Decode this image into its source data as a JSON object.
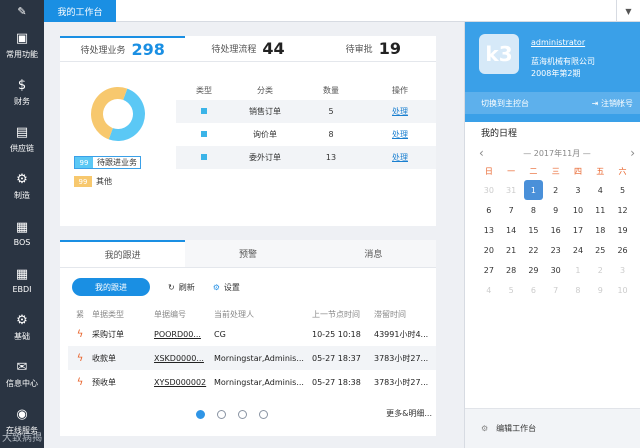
{
  "nav": {
    "items": [
      {
        "label": "常用功能",
        "icon": "bookmark-icon",
        "glyph": "▣"
      },
      {
        "label": "财务",
        "icon": "finance-coin-icon",
        "glyph": "$"
      },
      {
        "label": "供应链",
        "icon": "box-icon",
        "glyph": "▤"
      },
      {
        "label": "制造",
        "icon": "gear-icon",
        "glyph": "⚙"
      },
      {
        "label": "BOS",
        "icon": "grid-icon",
        "glyph": "▦"
      },
      {
        "label": "EBDI",
        "icon": "grid-icon",
        "glyph": "▦"
      },
      {
        "label": "基础",
        "icon": "settings-icon",
        "glyph": "⚙"
      },
      {
        "label": "信息中心",
        "icon": "mail-icon",
        "glyph": "✉"
      },
      {
        "label": "在线服务",
        "icon": "service-icon",
        "glyph": "◉"
      }
    ],
    "watermark": "大致病揭"
  },
  "topbar": {
    "tab_label": "我的工作台",
    "dropdown": "▼"
  },
  "summary": {
    "stats": [
      {
        "label": "待处理业务",
        "count": "298"
      },
      {
        "label": "待处理流程",
        "count": "44"
      },
      {
        "label": "待审批",
        "count": "19"
      }
    ],
    "donut": [
      {
        "name": "待跟进业务",
        "value": 99,
        "color": "#5bc8f5"
      },
      {
        "name": "其他",
        "value": 99,
        "color": "#f7c86e"
      }
    ],
    "legend": [
      {
        "badge": "99",
        "label": "待跟进业务",
        "color": "#5bc8f5"
      },
      {
        "badge": "99",
        "label": "其他",
        "color": "#f7c86e"
      }
    ],
    "table": {
      "headers": [
        "类型",
        "分类",
        "数量",
        "操作"
      ],
      "rows": [
        {
          "category": "销售订单",
          "count": "5",
          "action": "处理"
        },
        {
          "category": "询价单",
          "count": "8",
          "action": "处理"
        },
        {
          "category": "委外订单",
          "count": "13",
          "action": "处理"
        }
      ]
    }
  },
  "followup": {
    "tabs": [
      "我的跟进",
      "预警",
      "消息"
    ],
    "toolbar": {
      "mine": "我的跟进",
      "refresh": "刷新",
      "settings": "设置"
    },
    "headers": [
      "紧",
      "单据类型",
      "单据编号",
      "当前处理人",
      "上一节点时间",
      "滞留时间"
    ],
    "rows": [
      {
        "type": "采购订单",
        "no": "POORD00...",
        "handler": "CG",
        "time": "10-25 10:18",
        "stay": "43991小时4..."
      },
      {
        "type": "收款单",
        "no": "XSKD0000...",
        "handler": "Morningstar,Adminis...",
        "time": "05-27 18:37",
        "stay": "3783小时27..."
      },
      {
        "type": "预收单",
        "no": "XYSD000002",
        "handler": "Morningstar,Adminis...",
        "time": "05-27 18:38",
        "stay": "3783小时27..."
      }
    ],
    "more": "更多&明细..."
  },
  "profile": {
    "logo": "k3",
    "username": "administrator",
    "org": "蓝海机械有限公司",
    "period": "2008年第2期",
    "switch_console": "切换到主控台",
    "logout": "注销帐号"
  },
  "calendar": {
    "title": "我的日程",
    "month_label": "— 2017年11月 —",
    "weekdays": [
      "日",
      "一",
      "二",
      "三",
      "四",
      "五",
      "六"
    ],
    "weeks": [
      [
        "30",
        "31",
        "1",
        "2",
        "3",
        "4",
        "5"
      ],
      [
        "6",
        "7",
        "8",
        "9",
        "10",
        "11",
        "12"
      ],
      [
        "13",
        "14",
        "15",
        "16",
        "17",
        "18",
        "19"
      ],
      [
        "20",
        "21",
        "22",
        "23",
        "24",
        "25",
        "26"
      ],
      [
        "27",
        "28",
        "29",
        "30",
        "1",
        "2",
        "3"
      ],
      [
        "4",
        "5",
        "6",
        "7",
        "8",
        "9",
        "10"
      ]
    ],
    "edit_label": "编辑工作台"
  }
}
